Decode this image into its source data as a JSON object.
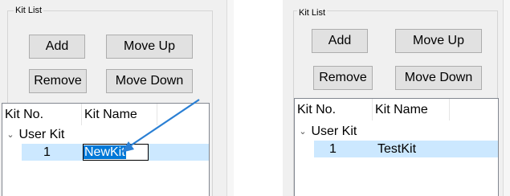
{
  "left_panel": {
    "group_title": "Kit List",
    "buttons": {
      "add": "Add",
      "move_up": "Move Up",
      "remove": "Remove",
      "move_down": "Move Down"
    },
    "columns": {
      "kit_no": "Kit No.",
      "kit_name": "Kit Name"
    },
    "tree": {
      "group_label": "User Kit",
      "row_number": "1",
      "row_name_editing": "NewKit"
    }
  },
  "right_panel": {
    "group_title": "Kit List",
    "buttons": {
      "add": "Add",
      "move_up": "Move Up",
      "remove": "Remove",
      "move_down": "Move Down"
    },
    "columns": {
      "kit_no": "Kit No.",
      "kit_name": "Kit Name"
    },
    "tree": {
      "group_label": "User Kit",
      "row_number": "1",
      "row_name": "TestKit"
    }
  },
  "colors": {
    "arrow": "#2a7fd4",
    "selection_row": "#cce8ff",
    "edit_highlight": "#0078d7"
  },
  "icons": {
    "expand": "chevron-down-icon",
    "pointer": "arrow-icon"
  }
}
